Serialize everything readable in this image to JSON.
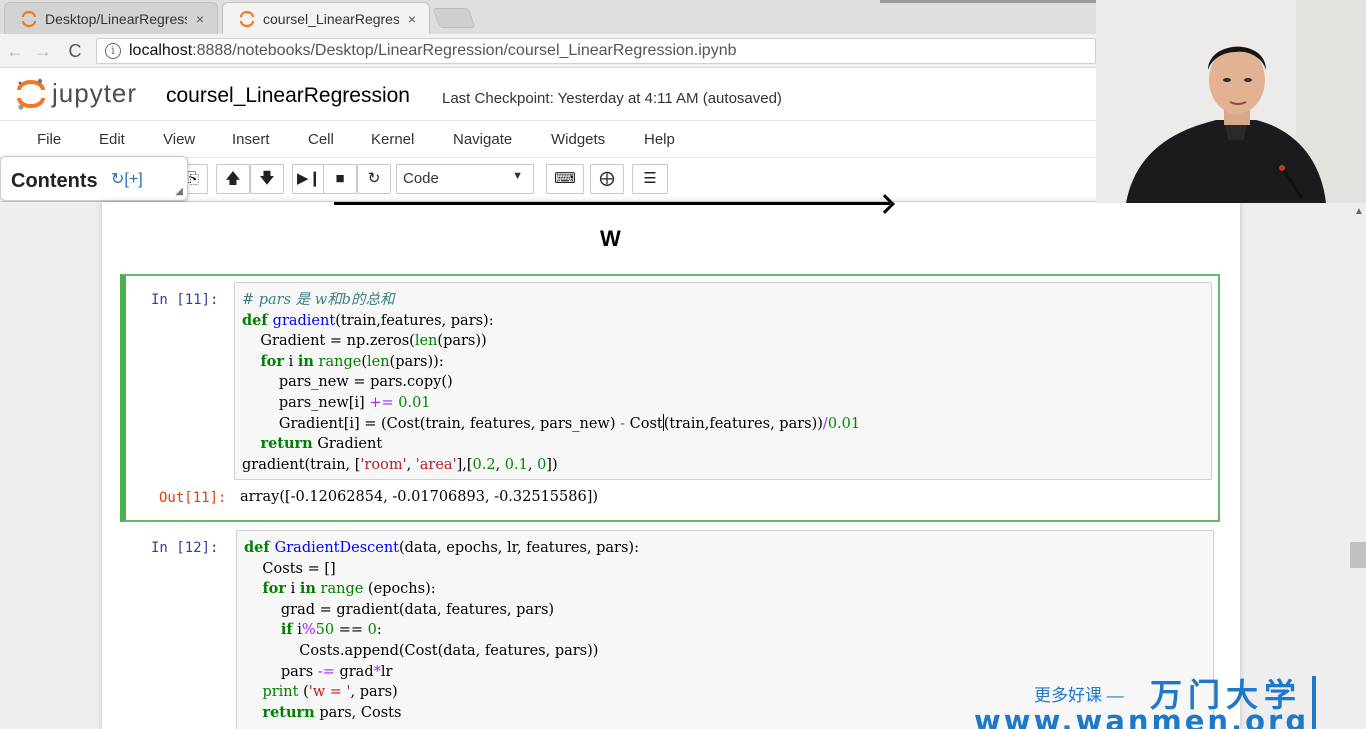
{
  "browser": {
    "tabs": [
      {
        "title": "Desktop/LinearRegress",
        "close": "×",
        "active": false
      },
      {
        "title": "coursel_LinearRegressi",
        "close": "×",
        "active": true
      }
    ],
    "back_glyph": "←",
    "forward_glyph": "→",
    "reload_glyph": "C",
    "url_host": "localhost",
    "url_rest": ":8888/notebooks/Desktop/LinearRegression/coursel_LinearRegression.ipynb"
  },
  "jupyter": {
    "logo_text": "jupyter",
    "notebook_title": "coursel_LinearRegression",
    "checkpoint": "Last Checkpoint: Yesterday at 4:11 AM (autosaved)",
    "menu": [
      "File",
      "Edit",
      "View",
      "Insert",
      "Cell",
      "Kernel",
      "Navigate",
      "Widgets",
      "Help"
    ],
    "cell_type": "Code"
  },
  "toc": {
    "title": "Contents",
    "icons": "↻[+]"
  },
  "markdown": {
    "label": "W"
  },
  "cells": [
    {
      "prompt_in": "In  [11]:",
      "lines": [
        [
          [
            "cm",
            "# pars 是 w和b的总和"
          ]
        ],
        [
          [
            "kw",
            "def "
          ],
          [
            "fn",
            "gradient"
          ],
          [
            "",
            "(train,features, pars):"
          ]
        ],
        [
          [
            "",
            "    Gradient = np.zeros("
          ],
          [
            "bi",
            "len"
          ],
          [
            "",
            "(pars))"
          ]
        ],
        [
          [
            "",
            "    "
          ],
          [
            "kw",
            "for"
          ],
          [
            "",
            " i "
          ],
          [
            "kw",
            "in"
          ],
          [
            "",
            " "
          ],
          [
            "bi",
            "range"
          ],
          [
            "",
            "("
          ],
          [
            "bi",
            "len"
          ],
          [
            "",
            "(pars)):"
          ]
        ],
        [
          [
            "",
            "        pars_new = pars.copy()"
          ]
        ],
        [
          [
            "",
            "        pars_new[i] "
          ],
          [
            "op",
            "+="
          ],
          [
            "",
            " "
          ],
          [
            "num",
            "0.01"
          ]
        ],
        [
          [
            "",
            "        Gradient[i] = (Cost(train, features, pars_new) "
          ],
          [
            "op",
            "-"
          ],
          [
            "",
            " Cost"
          ],
          [
            "cursor",
            ""
          ],
          [
            "",
            "(train,features, pars))"
          ],
          [
            "op",
            "/"
          ],
          [
            "num",
            "0.01"
          ]
        ],
        [
          [
            "",
            "    "
          ],
          [
            "kw",
            "return"
          ],
          [
            "",
            " Gradient"
          ]
        ],
        [
          [
            "",
            "gradient(train, ["
          ],
          [
            "str",
            "'room'"
          ],
          [
            "",
            ", "
          ],
          [
            "str",
            "'area'"
          ],
          [
            "",
            "],["
          ],
          [
            "num",
            "0.2"
          ],
          [
            "",
            ", "
          ],
          [
            "num",
            "0.1"
          ],
          [
            "",
            ", "
          ],
          [
            "num",
            "0"
          ],
          [
            "",
            "])"
          ]
        ]
      ],
      "prompt_out": "Out[11]:",
      "output": "array([-0.12062854, -0.01706893, -0.32515586])"
    },
    {
      "prompt_in": "In  [12]:",
      "lines": [
        [
          [
            "kw",
            "def "
          ],
          [
            "fn",
            "GradientDescent"
          ],
          [
            "",
            "(data, epochs, lr, features, pars):"
          ]
        ],
        [
          [
            "",
            "    Costs = []"
          ]
        ],
        [
          [
            "",
            "    "
          ],
          [
            "kw",
            "for"
          ],
          [
            "",
            " i "
          ],
          [
            "kw",
            "in"
          ],
          [
            "",
            " "
          ],
          [
            "bi",
            "range"
          ],
          [
            "",
            " (epochs):"
          ]
        ],
        [
          [
            "",
            "        grad = gradient(data, features, pars)"
          ]
        ],
        [
          [
            "",
            "        "
          ],
          [
            "kw",
            "if"
          ],
          [
            "",
            " i"
          ],
          [
            "op",
            "%"
          ],
          [
            "num",
            "50"
          ],
          [
            "",
            " == "
          ],
          [
            "num",
            "0"
          ],
          [
            "",
            ":"
          ]
        ],
        [
          [
            "",
            "            Costs.append(Cost(data, features, pars))"
          ]
        ],
        [
          [
            "",
            "        pars "
          ],
          [
            "op",
            "-="
          ],
          [
            "",
            " grad"
          ],
          [
            "op",
            "*"
          ],
          [
            "",
            "lr"
          ]
        ],
        [
          [
            "",
            "    "
          ],
          [
            "bi",
            "print"
          ],
          [
            "",
            " ("
          ],
          [
            "str",
            "'w = '"
          ],
          [
            "",
            ", pars)"
          ]
        ],
        [
          [
            "",
            "    "
          ],
          [
            "kw",
            "return"
          ],
          [
            "",
            " pars, Costs"
          ]
        ]
      ]
    }
  ],
  "watermark": {
    "slogan": "更多好课 —",
    "brand": "万门大学",
    "url": "www.wanmen.org"
  }
}
